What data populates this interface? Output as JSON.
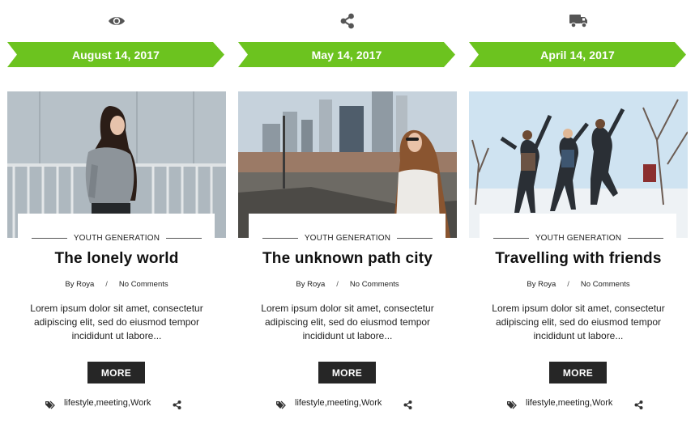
{
  "posts": [
    {
      "top_icon": "eye-icon",
      "date": "August 14, 2017",
      "photo": "woman-in-grey-sweater-on-balcony",
      "category": "YOUTH GENERATION",
      "title": "The lonely world",
      "author": "By Roya",
      "comments": "No Comments",
      "excerpt": "Lorem ipsum dolor sit amet, consectetur adipiscing elit, sed do eiusmod tempor incididunt ut labore...",
      "more_label": "MORE",
      "tags": [
        "lifestyle",
        "meeting",
        "Work"
      ]
    },
    {
      "top_icon": "share-icon",
      "date": "May 14, 2017",
      "photo": "woman-with-city-skyline",
      "category": "YOUTH GENERATION",
      "title": "The unknown path city",
      "author": "By Roya",
      "comments": "No Comments",
      "excerpt": "Lorem ipsum dolor sit amet, consectetur adipiscing elit, sed do eiusmod tempor incididunt ut labore...",
      "more_label": "MORE",
      "tags": [
        "lifestyle",
        "meeting",
        "Work"
      ]
    },
    {
      "top_icon": "truck-icon",
      "date": "April 14, 2017",
      "photo": "friends-jumping-in-snow",
      "category": "YOUTH GENERATION",
      "title": "Travelling with friends",
      "author": "By Roya",
      "comments": "No Comments",
      "excerpt": "Lorem ipsum dolor sit amet, consectetur adipiscing elit, sed do eiusmod tempor incididunt ut labore...",
      "more_label": "MORE",
      "tags": [
        "lifestyle",
        "meeting",
        "Work"
      ]
    }
  ],
  "meta_separator": "/",
  "tag_separator": ",",
  "colors": {
    "ribbon": "#6cc31f",
    "button": "#262626",
    "icon": "#555555"
  }
}
